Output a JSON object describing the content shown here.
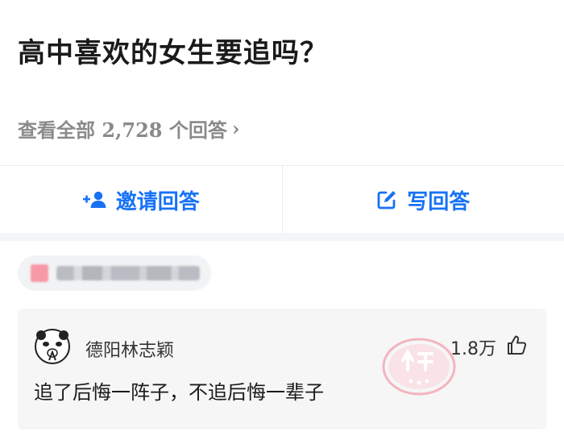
{
  "question": {
    "title": "高中喜欢的女生要追吗？",
    "view_all": "查看全部 2,728 个回答",
    "chevron": "›"
  },
  "actions": {
    "invite_label": "邀请回答",
    "write_label": "写回答"
  },
  "colors": {
    "accent": "#1772f6",
    "muted": "#8a8a8a",
    "stamp": "#f4a4b2"
  },
  "comment": {
    "username": "德阳林志颖",
    "likes": "1.8万",
    "text": "追了后悔一阵子，不追后悔一辈子",
    "badge_icon": "shen-ping-stamp",
    "like_icon": "thumbs-up-icon"
  }
}
